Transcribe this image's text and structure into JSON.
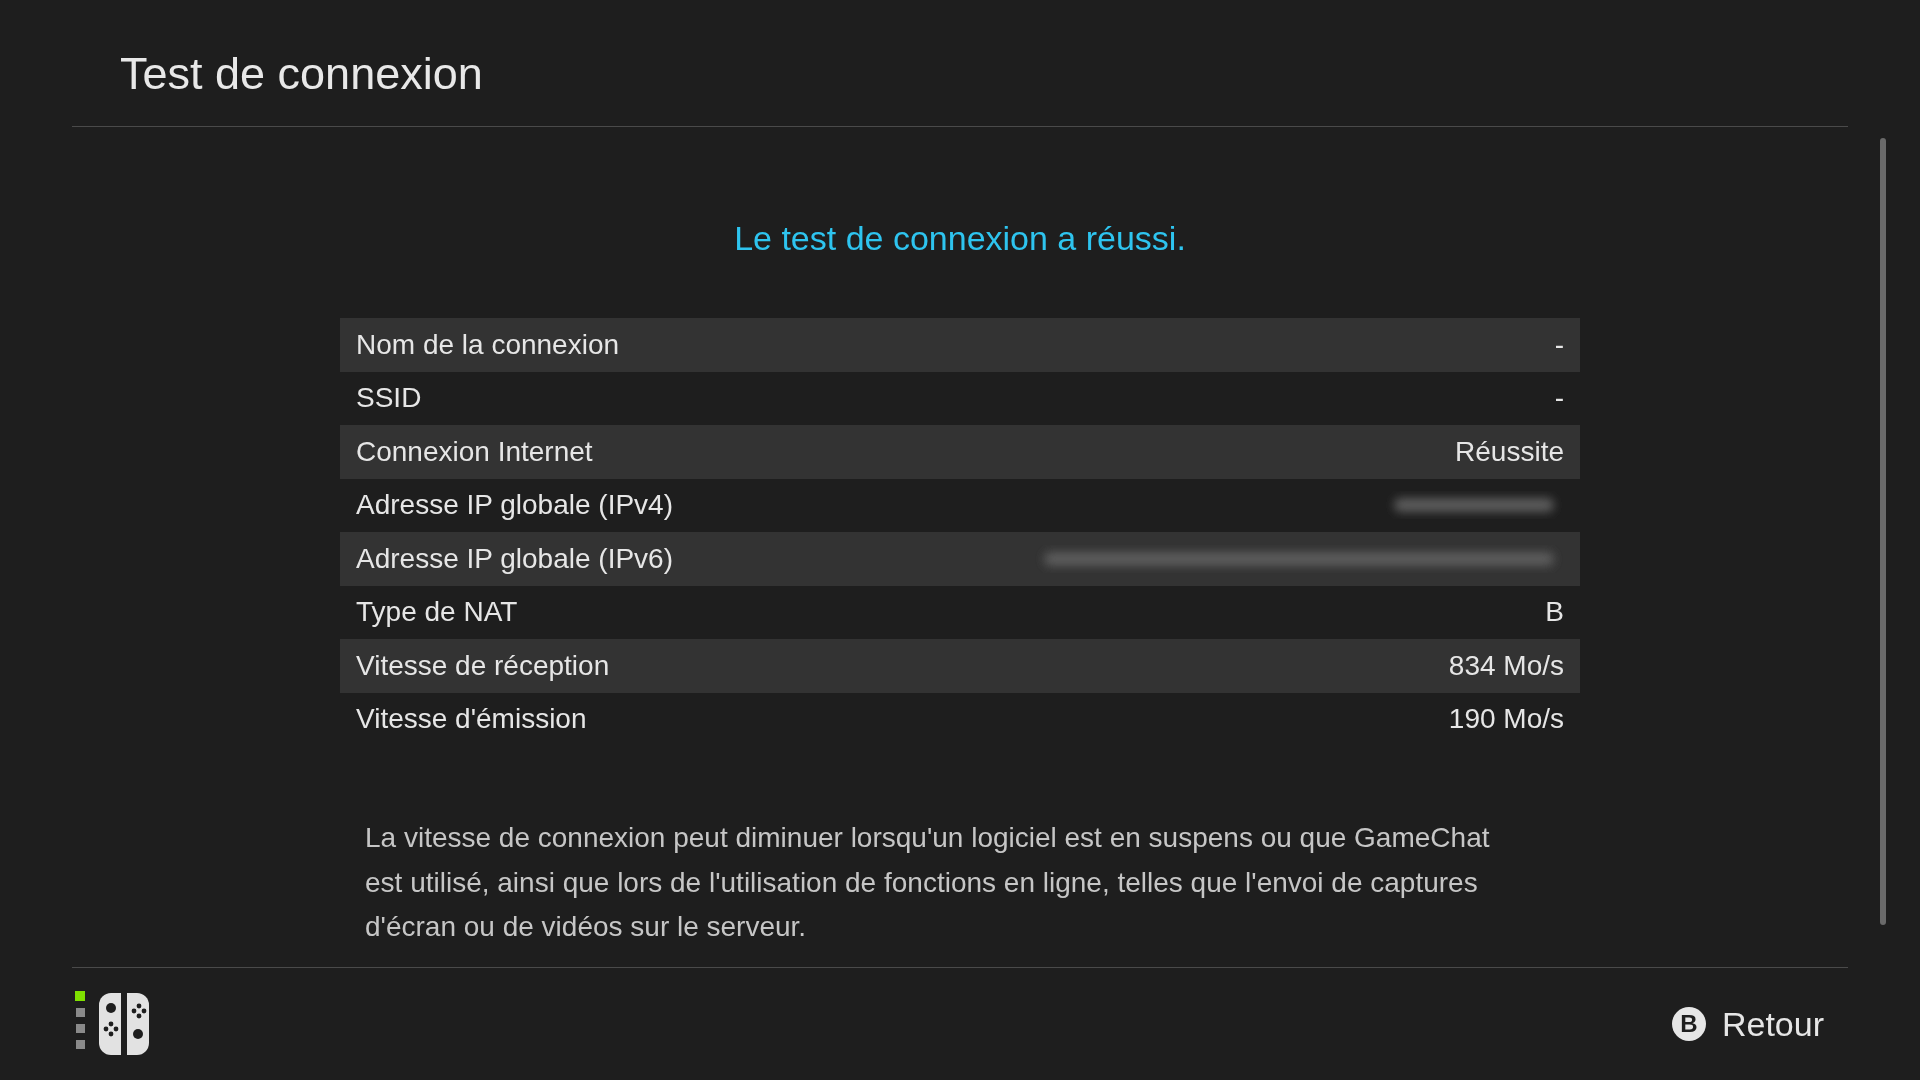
{
  "header": {
    "title": "Test de connexion"
  },
  "result": {
    "message": "Le test de connexion a réussi."
  },
  "rows": [
    {
      "label": "Nom de la connexion",
      "kind": "text",
      "value": "-"
    },
    {
      "label": "SSID",
      "kind": "text",
      "value": "-"
    },
    {
      "label": "Connexion Internet",
      "kind": "text",
      "value": "Réussite"
    },
    {
      "label": "Adresse IP globale (IPv4)",
      "kind": "blurred"
    },
    {
      "label": "Adresse IP globale (IPv6)",
      "kind": "blurred"
    },
    {
      "label": "Type de NAT",
      "kind": "text",
      "value": "B"
    },
    {
      "label": "Vitesse de réception",
      "kind": "text",
      "value": "834 Mo/s"
    },
    {
      "label": "Vitesse d'émission",
      "kind": "text",
      "value": "190 Mo/s"
    }
  ],
  "note": "La vitesse de connexion peut diminuer lorsqu'un logiciel est en suspens ou que GameChat est utilisé, ainsi que lors de l'utilisation de fonctions en ligne, telles que l'envoi de captures d'écran ou de vidéos sur le serveur.",
  "footer": {
    "back_key": "B",
    "back_label": "Retour"
  }
}
